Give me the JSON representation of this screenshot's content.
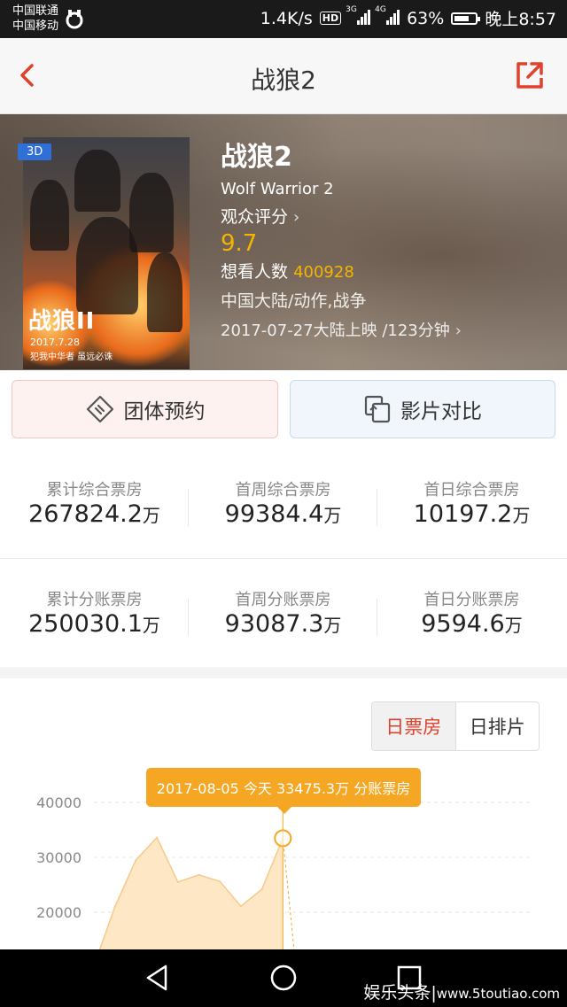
{
  "status_bar": {
    "carrier_1": "中国联通",
    "carrier_2": "中国移动",
    "speed": "1.4K/s",
    "hd": "HD",
    "net_1": "3G",
    "net_2": "4G",
    "battery": "63%",
    "time": "晚上8:57"
  },
  "nav": {
    "title": "战狼2",
    "back_icon": "chevron-left-icon",
    "share_icon": "share-out-icon",
    "accent": "#e0412d"
  },
  "movie": {
    "badge": "3D",
    "title": "战狼2",
    "english_title": "Wolf Warrior 2",
    "rating_label": "观众评分",
    "rating": "9.7",
    "want_label": "想看人数",
    "want_count": "400928",
    "genre": "中国大陆/动作,战争",
    "release": "2017-07-27大陆上映 /123分钟",
    "poster": {
      "title": "战狼II",
      "date": "2017.7.28",
      "tagline": "犯我中华者 虽远必诛"
    }
  },
  "actions": {
    "group_booking": "团体预约",
    "film_compare": "影片对比"
  },
  "box_office": {
    "unit": "万",
    "row1": [
      {
        "label": "累计综合票房",
        "value": "267824.2"
      },
      {
        "label": "首周综合票房",
        "value": "99384.4"
      },
      {
        "label": "首日综合票房",
        "value": "10197.2"
      }
    ],
    "row2": [
      {
        "label": "累计分账票房",
        "value": "250030.1"
      },
      {
        "label": "首周分账票房",
        "value": "93087.3"
      },
      {
        "label": "首日分账票房",
        "value": "9594.6"
      }
    ]
  },
  "chart_controls": {
    "daily_box_office": "日票房",
    "daily_schedule": "日排片"
  },
  "chart_data": {
    "type": "area",
    "tooltip": "2017-08-05 今天 33475.3万 分账票房",
    "y_ticks": [
      "40000",
      "30000",
      "20000"
    ],
    "ylim": [
      10000,
      40000
    ],
    "x": [
      0,
      1,
      2,
      3,
      4,
      5,
      6,
      7,
      8,
      9
    ],
    "values": [
      10197,
      21000,
      29500,
      33600,
      25500,
      26800,
      25600,
      21100,
      24200,
      33475.3
    ],
    "highlight_index": 9,
    "colors": {
      "fill": "#fde7c5",
      "line": "#f5a623",
      "grid": "#e6e6e6"
    }
  },
  "system_nav": {
    "back_icon": "nav-back-icon",
    "home_icon": "nav-home-icon",
    "recents_icon": "nav-recents-icon"
  },
  "watermark": {
    "text": "娱乐头条",
    "url": "www.5toutiao.com"
  }
}
